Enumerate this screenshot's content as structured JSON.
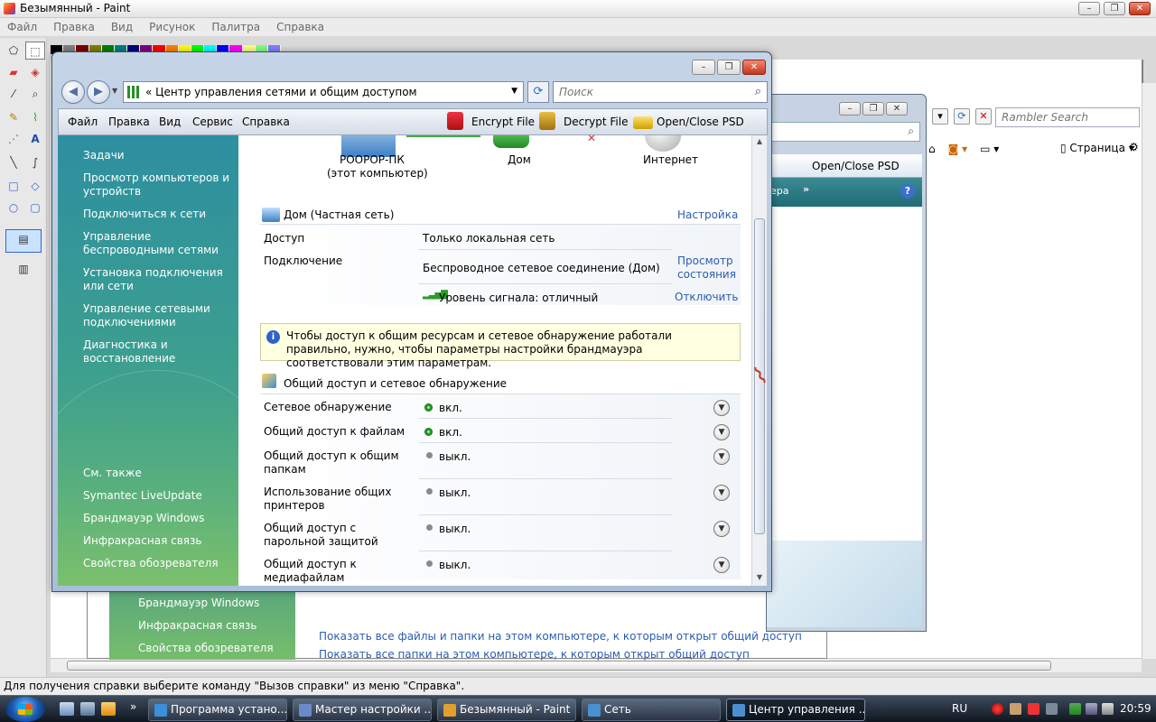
{
  "paint": {
    "title": "Безымянный - Paint",
    "menu": [
      "Файл",
      "Правка",
      "Вид",
      "Рисунок",
      "Палитра",
      "Справка"
    ],
    "status": "Для получения справки выберите команду \"Вызов справки\" из меню \"Справка\".",
    "palette": [
      "#000000",
      "#808080",
      "#800000",
      "#808000",
      "#008000",
      "#008080",
      "#000080",
      "#800080",
      "#ff0000",
      "#ff8000",
      "#ffff00",
      "#00ff00",
      "#00ffff",
      "#0000ff",
      "#ff00ff",
      "#ffff80",
      "#80ff80",
      "#8080ff"
    ]
  },
  "ie": {
    "search_placeholder": "Rambler Search",
    "page_menu": "Страница",
    "open_close": "Open/Close PSD",
    "nav_fragment": "ера"
  },
  "bg_network": {
    "left_links": [
      "Брандмауэр Windows",
      "Инфракрасная связь",
      "Свойства обозревателя"
    ],
    "links": [
      "Показать все файлы и папки на этом компьютере, к которым открыт общий доступ",
      "Показать все папки на этом компьютере, к которым открыт общий доступ"
    ]
  },
  "window": {
    "address": "Центр управления сетями и общим доступом",
    "address_prefix": "«",
    "search_placeholder": "Поиск",
    "menu": [
      "Файл",
      "Правка",
      "Вид",
      "Сервис",
      "Справка"
    ],
    "toolbar": {
      "encrypt": "Encrypt File",
      "decrypt": "Decrypt File",
      "open_close": "Open/Close PSD"
    },
    "left": {
      "tasks_title": "Задачи",
      "tasks": [
        "Просмотр компьютеров и устройств",
        "Подключиться к сети",
        "Управление беспроводными сетями",
        "Установка подключения или сети",
        "Управление сетевыми подключениями",
        "Диагностика и восстановление"
      ],
      "see_also_title": "См. также",
      "see_also": [
        "Symantec LiveUpdate",
        "Брандмауэр Windows",
        "Инфракрасная связь",
        "Свойства обозревателя"
      ]
    },
    "map": {
      "computer": "РООРОР-ПК",
      "computer_sub": "(этот компьютер)",
      "network": "Дом",
      "internet": "Интернет"
    },
    "network": {
      "title": "Дом (Частная сеть)",
      "settings_link": "Настройка",
      "access_label": "Доступ",
      "access_value": "Только локальная сеть",
      "connection_label": "Подключение",
      "connection_value": "Беспроводное сетевое соединение (Дом)",
      "view_status_link": "Просмотр состояния",
      "signal": "Уровень сигнала: отличный",
      "disconnect_link": "Отключить"
    },
    "info": "Чтобы доступ к общим ресурсам и сетевое обнаружение работали правильно, нужно, чтобы параметры настройки брандмауэра соответствовали этим параметрам.",
    "sharing": {
      "title": "Общий доступ и сетевое обнаружение",
      "rows": [
        {
          "label": "Сетевое обнаружение",
          "state": "вкл.",
          "on": true
        },
        {
          "label": "Общий доступ к файлам",
          "state": "вкл.",
          "on": true
        },
        {
          "label": "Общий доступ к общим папкам",
          "state": "выкл.",
          "on": false
        },
        {
          "label": "Использование общих принтеров",
          "state": "выкл.",
          "on": false
        },
        {
          "label": "Общий доступ с парольной защитой",
          "state": "выкл.",
          "on": false
        },
        {
          "label": "Общий доступ к медиафайлам",
          "state": "выкл.",
          "on": false
        }
      ]
    }
  },
  "taskbar": {
    "buttons": [
      {
        "label": "Программа устано...",
        "color": "#3a8fd8"
      },
      {
        "label": "Мастер настройки ...",
        "color": "#6a8bc8"
      },
      {
        "label": "Безымянный - Paint",
        "color": "#e0a030"
      },
      {
        "label": "Сеть",
        "color": "#4a90d0"
      },
      {
        "label": "Центр управления ...",
        "color": "#4a90d0"
      }
    ],
    "lang": "RU",
    "clock": "20:59"
  }
}
